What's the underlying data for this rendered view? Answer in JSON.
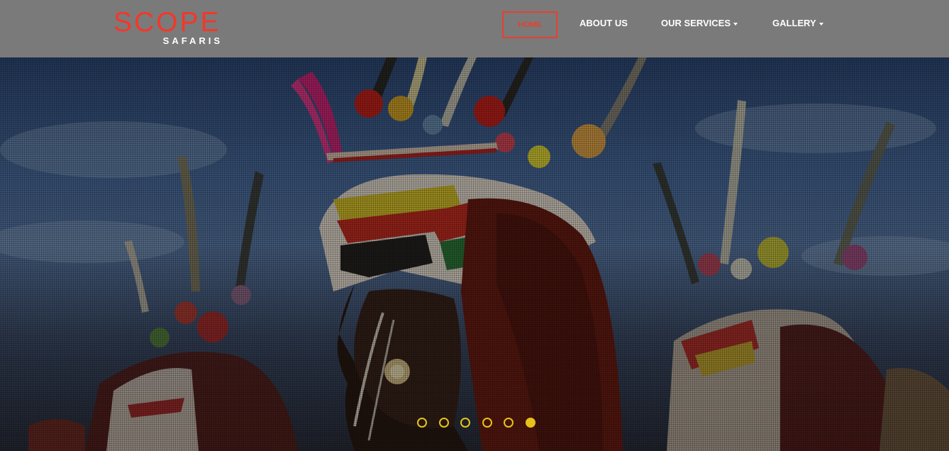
{
  "brand": {
    "name": "SCOPE",
    "tagline": "SAFARIS",
    "accent_color": "#f4372a"
  },
  "nav": {
    "items": [
      {
        "label": "HOME",
        "active": true
      },
      {
        "label": "ABOUT US",
        "dropdown": false
      },
      {
        "label": "OUR SERVICES",
        "dropdown": true
      },
      {
        "label": "GALLERY",
        "dropdown": true
      }
    ]
  },
  "hero": {
    "image_subject": "samburu-warriors-headdress-photo",
    "carousel": {
      "slide_count": 6,
      "active_index": 5,
      "indicator_color": "#e6c21b"
    }
  }
}
